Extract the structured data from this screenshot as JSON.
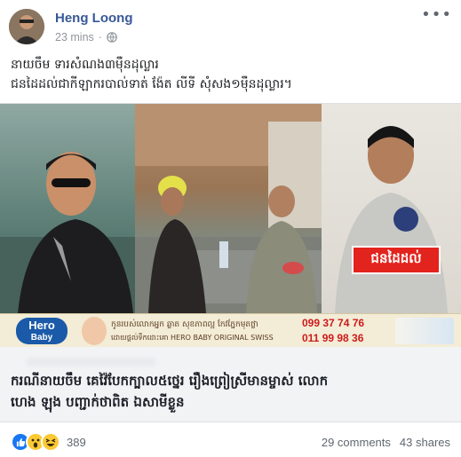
{
  "post": {
    "author": "Heng Loong",
    "time": "23 mins",
    "caption_lines": [
      "នាយចឹម ទារសំណង៣ម៉ឺនដុល្លារ",
      "ជនដៃដល់ជាកីឡាករបាល់ទាត់ ង៉ែត លីទី សុំសង១ម៉ឺនដុល្លារ។"
    ]
  },
  "link": {
    "suspect_label": "ជនដៃដល់",
    "ad": {
      "logo_line1": "Hero",
      "logo_line2": "Baby",
      "text1": "កូនរបស់លោកអ្នក ឆ្លាត សុខភាពល្អ កែវ​ភ្នែកមុតថ្លា",
      "text2": "ដោយផ្តល់​ទឹកដោះគោ HERO BABY ORIGINAL SWISS",
      "phone1": "099 37 74 76",
      "phone2": "011 99 98 36"
    },
    "title_lines": [
      "ករណីនាយចឹម គេវ៉ៃបែកក្បាល៥ថ្នេរ រឿងព្រៀស្រីមានម្ចាស់ លោក",
      "ហេង ឡុង បញ្ជាក់ថាពិត ឯសាមីខ្លួន"
    ]
  },
  "footer": {
    "reaction_count": "389",
    "comments": "29 comments",
    "shares": "43 shares"
  },
  "colors": {
    "author_link": "#385898",
    "like_blue": "#1877f2",
    "badge_red": "#e3231d"
  }
}
